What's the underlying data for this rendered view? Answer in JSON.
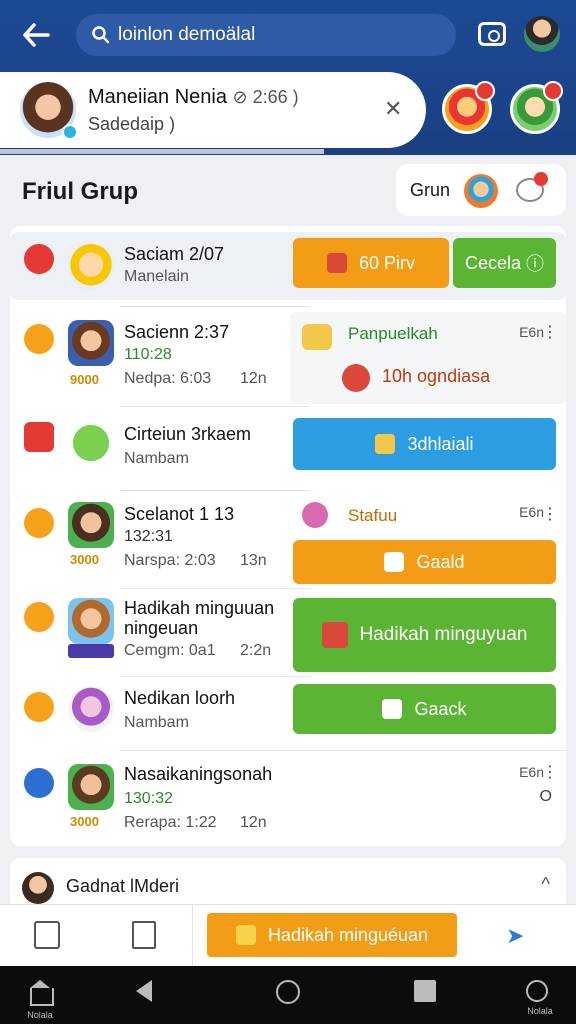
{
  "topbar": {
    "search_text": "loinlon demoälal"
  },
  "chat_header": {
    "name": "Maneiian Nenia",
    "time": "2:66 )",
    "subtitle": "Sadedaip )",
    "close_icon": "close-icon"
  },
  "section": {
    "title": "Friul Grup",
    "side_label": "Grun"
  },
  "rows": [
    {
      "name": "Saciam 2/07",
      "line2": "",
      "line3": "Manelain",
      "time": "",
      "coin": ""
    },
    {
      "name": "Sacienn 2:37",
      "line2": "110:28",
      "line3": "Nedpa: 6:03",
      "time": "12n",
      "coin": "9000"
    },
    {
      "name": "Cirteiun 3rkaem",
      "line2": "",
      "line3": "Nambam",
      "time": "",
      "coin": ""
    },
    {
      "name": "Scelanot 1 13",
      "line2": "132:31",
      "line3": "Narspa: 2:03",
      "time": "13n",
      "coin": "3000"
    },
    {
      "name": "Hadikah minguuan",
      "name2": "ningeuan",
      "line2": "",
      "line3": "Cemgm: 0a1",
      "time": "2:2n",
      "coin": ""
    },
    {
      "name": "Nedikan loorh",
      "line2": "",
      "line3": "Nambam",
      "time": "",
      "coin": ""
    },
    {
      "name": "Nasaikaningsonah",
      "line2": "130:32",
      "line3": "Rerapa: 1:22",
      "time": "12n",
      "coin": "3000"
    }
  ],
  "buttons": {
    "btn_orange_1": "60 Pirv",
    "btn_green_1": "Cecela",
    "panel1_title": "Panpuelkah",
    "panel1_time": "E6n",
    "panel1_sub": "10h ogndiasa",
    "btn_blue": "3dhlaiali",
    "panel2_title": "Stafuu",
    "panel2_time": "E6n",
    "btn_orange_2": "Gaald",
    "btn_green_2": "Hadikah minguyuan",
    "btn_green_3": "Gaack",
    "row7_time": "E6n",
    "row7_extra": "O"
  },
  "contact": {
    "name": "Gadnat lMderi"
  },
  "actionbar": {
    "main_label": "Hadikah minguéuan"
  },
  "navbar": {
    "home_label": "Nolala",
    "account_label": "Nolala"
  },
  "colors": {
    "primary": "#1d4a94",
    "orange": "#f39c16",
    "green": "#5cb435",
    "blue": "#2b9de0"
  }
}
